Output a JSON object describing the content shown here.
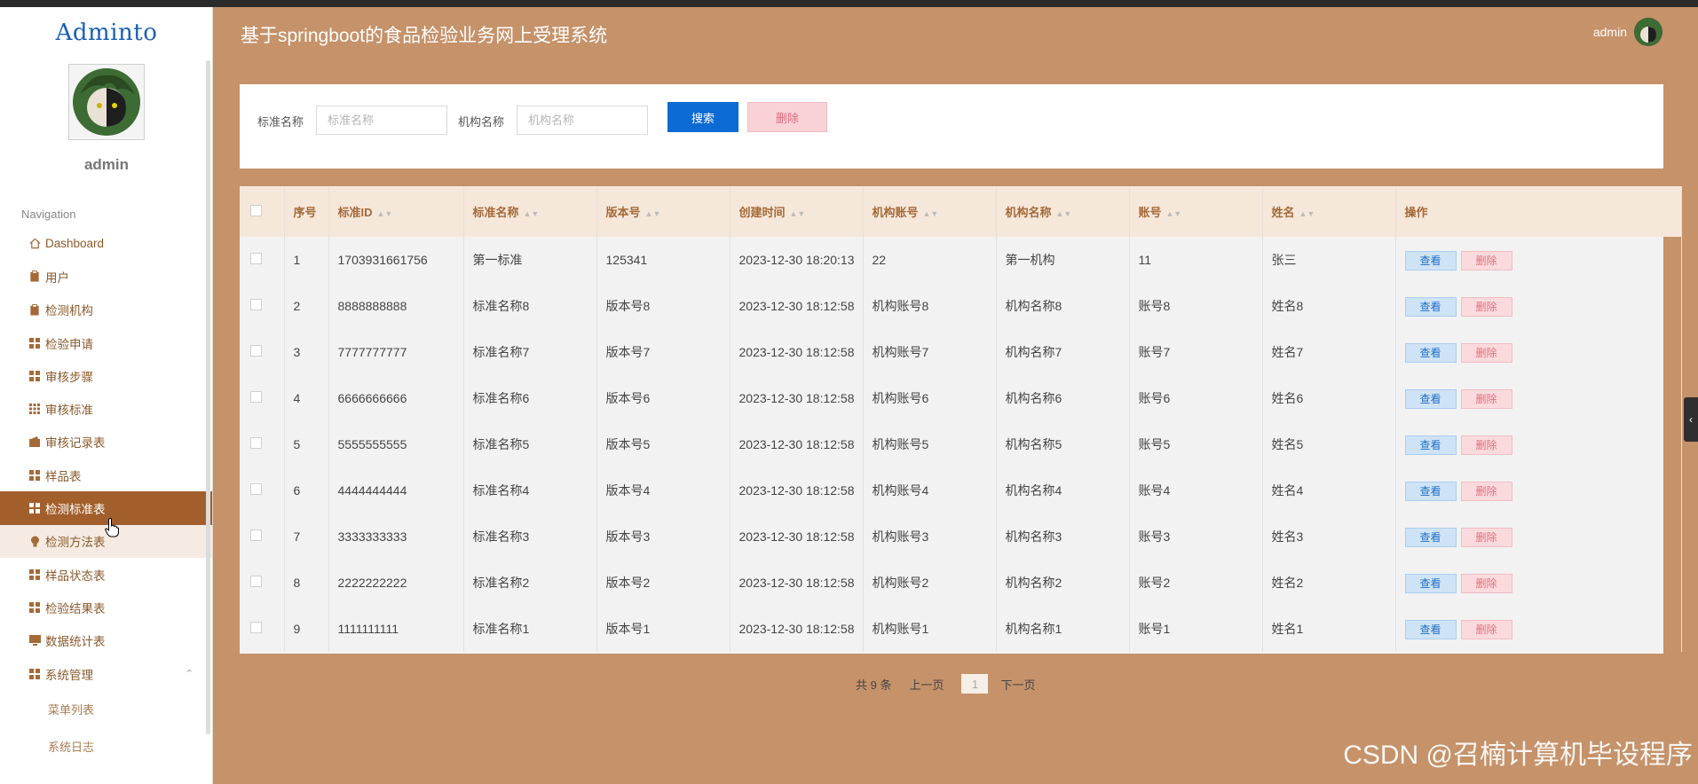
{
  "app": {
    "logo": "Adminto",
    "title": "基于springboot的食品检验业务网上受理系统",
    "top_username": "admin"
  },
  "sidebar": {
    "username": "admin",
    "nav_title": "Navigation",
    "items": [
      {
        "label": "Dashboard",
        "icon": "home-icon"
      },
      {
        "label": "用户",
        "icon": "clipboard-icon"
      },
      {
        "label": "检测机构",
        "icon": "clipboard-icon"
      },
      {
        "label": "检验申请",
        "icon": "grid-icon"
      },
      {
        "label": "审核步骤",
        "icon": "grid-icon"
      },
      {
        "label": "审核标准",
        "icon": "apps-icon"
      },
      {
        "label": "审核记录表",
        "icon": "wallet-icon"
      },
      {
        "label": "样品表",
        "icon": "grid-icon"
      },
      {
        "label": "检测标准表",
        "icon": "grid-icon"
      },
      {
        "label": "检测方法表",
        "icon": "bulb-icon"
      },
      {
        "label": "样品状态表",
        "icon": "grid-icon"
      },
      {
        "label": "检验结果表",
        "icon": "grid-icon"
      },
      {
        "label": "数据统计表",
        "icon": "monitor-icon"
      },
      {
        "label": "系统管理",
        "icon": "grid-icon"
      }
    ],
    "sub_items": [
      "菜单列表",
      "系统日志"
    ]
  },
  "search": {
    "label1": "标准名称",
    "placeholder1": "标准名称",
    "label2": "机构名称",
    "placeholder2": "机构名称",
    "search_button": "搜索",
    "delete_button": "删除"
  },
  "table": {
    "headers": [
      "序号",
      "标准ID",
      "标准名称",
      "版本号",
      "创建时间",
      "机构账号",
      "机构名称",
      "账号",
      "姓名",
      "操作"
    ],
    "view_label": "查看",
    "delete_label": "删除",
    "rows": [
      [
        "1",
        "1703931661756",
        "第一标准",
        "125341",
        "2023-12-30 18:20:13",
        "22",
        "第一机构",
        "11",
        "张三"
      ],
      [
        "2",
        "8888888888",
        "标准名称8",
        "版本号8",
        "2023-12-30 18:12:58",
        "机构账号8",
        "机构名称8",
        "账号8",
        "姓名8"
      ],
      [
        "3",
        "7777777777",
        "标准名称7",
        "版本号7",
        "2023-12-30 18:12:58",
        "机构账号7",
        "机构名称7",
        "账号7",
        "姓名7"
      ],
      [
        "4",
        "6666666666",
        "标准名称6",
        "版本号6",
        "2023-12-30 18:12:58",
        "机构账号6",
        "机构名称6",
        "账号6",
        "姓名6"
      ],
      [
        "5",
        "5555555555",
        "标准名称5",
        "版本号5",
        "2023-12-30 18:12:58",
        "机构账号5",
        "机构名称5",
        "账号5",
        "姓名5"
      ],
      [
        "6",
        "4444444444",
        "标准名称4",
        "版本号4",
        "2023-12-30 18:12:58",
        "机构账号4",
        "机构名称4",
        "账号4",
        "姓名4"
      ],
      [
        "7",
        "3333333333",
        "标准名称3",
        "版本号3",
        "2023-12-30 18:12:58",
        "机构账号3",
        "机构名称3",
        "账号3",
        "姓名3"
      ],
      [
        "8",
        "2222222222",
        "标准名称2",
        "版本号2",
        "2023-12-30 18:12:58",
        "机构账号2",
        "机构名称2",
        "账号2",
        "姓名2"
      ],
      [
        "9",
        "1111111111",
        "标准名称1",
        "版本号1",
        "2023-12-30 18:12:58",
        "机构账号1",
        "机构名称1",
        "账号1",
        "姓名1"
      ]
    ]
  },
  "pagination": {
    "total": "共 9 条",
    "prev": "上一页",
    "current": "1",
    "next": "下一页"
  },
  "watermark": "CSDN @召楠计算机毕设程序",
  "colors": {
    "background": "#c5926a",
    "active_nav": "#a25f2b",
    "search_button": "#0c6ad4",
    "table_header_bg": "#f6e7db"
  }
}
